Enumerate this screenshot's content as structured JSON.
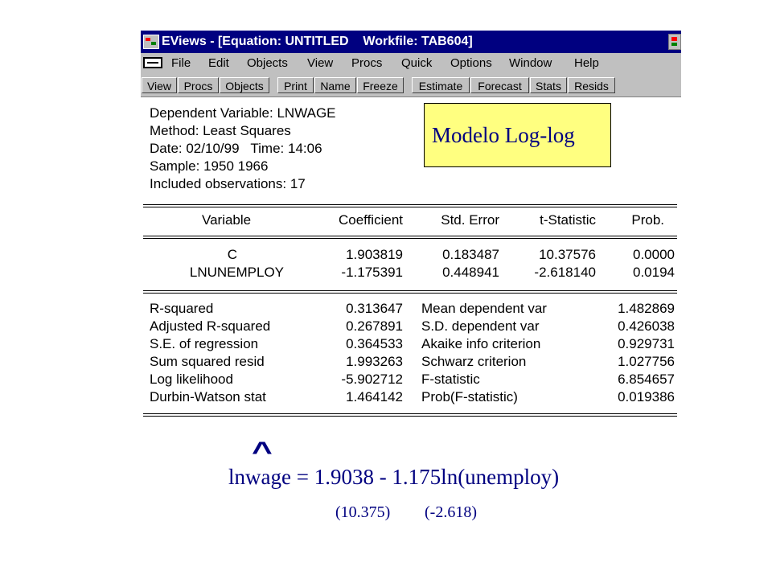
{
  "window": {
    "title": "EViews - [Equation: UNTITLED    Workfile: TAB604]"
  },
  "menu": [
    "File",
    "Edit",
    "Objects",
    "View",
    "Procs",
    "Quick",
    "Options",
    "Window",
    "Help"
  ],
  "toolbar": [
    "View",
    "Procs",
    "Objects",
    "Print",
    "Name",
    "Freeze",
    "Estimate",
    "Forecast",
    "Stats",
    "Resids"
  ],
  "header": {
    "dependent": "Dependent Variable: LNWAGE",
    "method": "Method: Least Squares",
    "date": "Date: 02/10/99   Time: 14:06",
    "sample": "Sample: 1950 1966",
    "observations": "Included observations: 17"
  },
  "callout": "Modelo Log-log",
  "coef_table": {
    "columns": [
      "Variable",
      "Coefficient",
      "Std. Error",
      "t-Statistic",
      "Prob."
    ],
    "rows": [
      [
        "C",
        "1.903819",
        "0.183487",
        "10.37576",
        "0.0000"
      ],
      [
        "LNUNEMPLOY",
        "-1.175391",
        "0.448941",
        "-2.618140",
        "0.0194"
      ]
    ]
  },
  "stats": [
    [
      "R-squared",
      "0.313647",
      "Mean dependent var",
      "1.482869"
    ],
    [
      "Adjusted R-squared",
      "0.267891",
      "S.D. dependent var",
      "0.426038"
    ],
    [
      "S.E. of regression",
      "0.364533",
      "Akaike info criterion",
      "0.929731"
    ],
    [
      "Sum squared resid",
      "1.993263",
      "Schwarz criterion",
      "1.027756"
    ],
    [
      "Log likelihood",
      "-5.902712",
      "F-statistic",
      "6.854657"
    ],
    [
      "Durbin-Watson stat",
      "1.464142",
      "Prob(F-statistic)",
      "0.019386"
    ]
  ],
  "annotation": {
    "hat": "^",
    "equation": "lnwage = 1.9038 - 1.175ln(unemploy)",
    "t_c": "(10.375)",
    "t_x": "(-2.618)"
  },
  "colors": {
    "titlebar": "#000080",
    "chrome": "#c0c0c0",
    "callout_bg": "#ffff80",
    "annotation_text": "#000080"
  }
}
